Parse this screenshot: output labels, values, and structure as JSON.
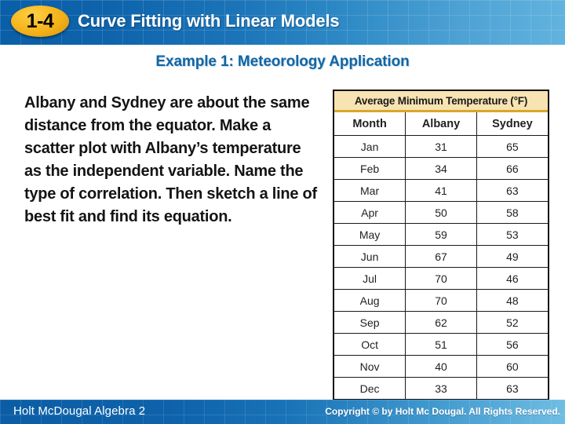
{
  "header": {
    "lesson_number": "1-4",
    "title": "Curve Fitting with Linear Models"
  },
  "subtitle": "Example 1: Meteorology Application",
  "body_text": "Albany and Sydney are about the same distance from the equator. Make a scatter plot with Albany’s temperature as the independent variable. Name the type of correlation. Then sketch a line of best fit and find its equation.",
  "table": {
    "caption": "Average Minimum Temperature (°F)",
    "columns": [
      "Month",
      "Albany",
      "Sydney"
    ],
    "rows": [
      [
        "Jan",
        "31",
        "65"
      ],
      [
        "Feb",
        "34",
        "66"
      ],
      [
        "Mar",
        "41",
        "63"
      ],
      [
        "Apr",
        "50",
        "58"
      ],
      [
        "May",
        "59",
        "53"
      ],
      [
        "Jun",
        "67",
        "49"
      ],
      [
        "Jul",
        "70",
        "46"
      ],
      [
        "Aug",
        "70",
        "48"
      ],
      [
        "Sep",
        "62",
        "52"
      ],
      [
        "Oct",
        "51",
        "56"
      ],
      [
        "Nov",
        "40",
        "60"
      ],
      [
        "Dec",
        "33",
        "63"
      ]
    ]
  },
  "chart_data": {
    "type": "table",
    "title": "Average Minimum Temperature (°F)",
    "categories": [
      "Jan",
      "Feb",
      "Mar",
      "Apr",
      "May",
      "Jun",
      "Jul",
      "Aug",
      "Sep",
      "Oct",
      "Nov",
      "Dec"
    ],
    "series": [
      {
        "name": "Albany",
        "values": [
          31,
          34,
          41,
          50,
          59,
          67,
          70,
          70,
          62,
          51,
          40,
          33
        ]
      },
      {
        "name": "Sydney",
        "values": [
          65,
          66,
          63,
          58,
          53,
          49,
          46,
          48,
          52,
          56,
          60,
          63
        ]
      }
    ],
    "xlabel": "Month",
    "ylabel": "Average Minimum Temperature (°F)"
  },
  "footer": {
    "left": "Holt McDougal Algebra 2",
    "right": "Copyright © by Holt Mc Dougal. All Rights Reserved."
  },
  "colors": {
    "header_blue_dark": "#0a5fa8",
    "header_blue_light": "#62b3de",
    "badge_gold": "#f5b31b",
    "subtitle_blue": "#1065a4",
    "table_caption_bg": "#f8e3b2",
    "table_caption_rule": "#d8a72a"
  }
}
